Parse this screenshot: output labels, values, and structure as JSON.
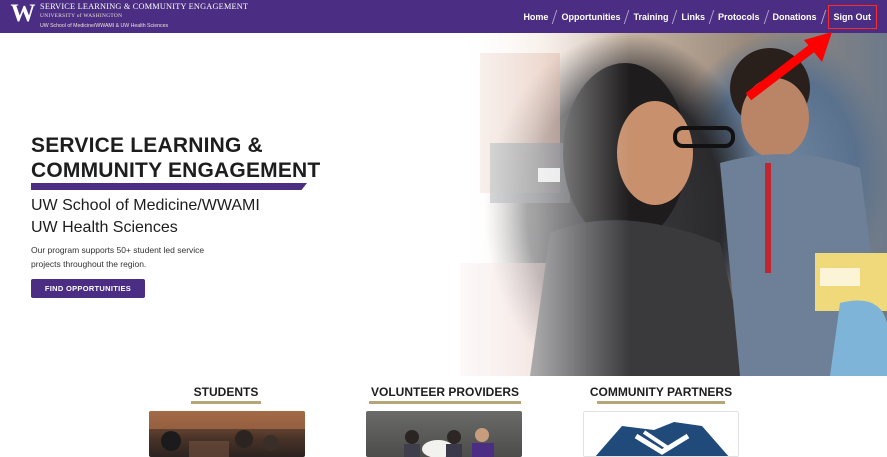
{
  "header": {
    "logo_letter": "W",
    "brand_title": "SERVICE LEARNING & COMMUNITY ENGAGEMENT",
    "brand_university": "UNIVERSITY of WASHINGTON",
    "brand_school": "UW School of Medicine/WWAMI & UW Health Sciences",
    "nav": [
      {
        "label": "Home"
      },
      {
        "label": "Opportunities"
      },
      {
        "label": "Training"
      },
      {
        "label": "Links"
      },
      {
        "label": "Protocols"
      },
      {
        "label": "Donations"
      },
      {
        "label": "Sign Out"
      }
    ],
    "brand_color": "#4b2e83"
  },
  "hero": {
    "title": "SERVICE LEARNING & COMMUNITY ENGAGEMENT",
    "subtitle_1": "UW School of Medicine/WWAMI",
    "subtitle_2": "UW Health Sciences",
    "description": "Our program supports 50+ student led service projects throughout the region.",
    "button_label": "FIND OPPORTUNITIES",
    "annotation_arrow_color": "#ff0000"
  },
  "categories": [
    {
      "title": "STUDENTS"
    },
    {
      "title": "VOLUNTEER PROVIDERS"
    },
    {
      "title": "COMMUNITY PARTNERS"
    }
  ],
  "accent_gold": "#b7a57a"
}
